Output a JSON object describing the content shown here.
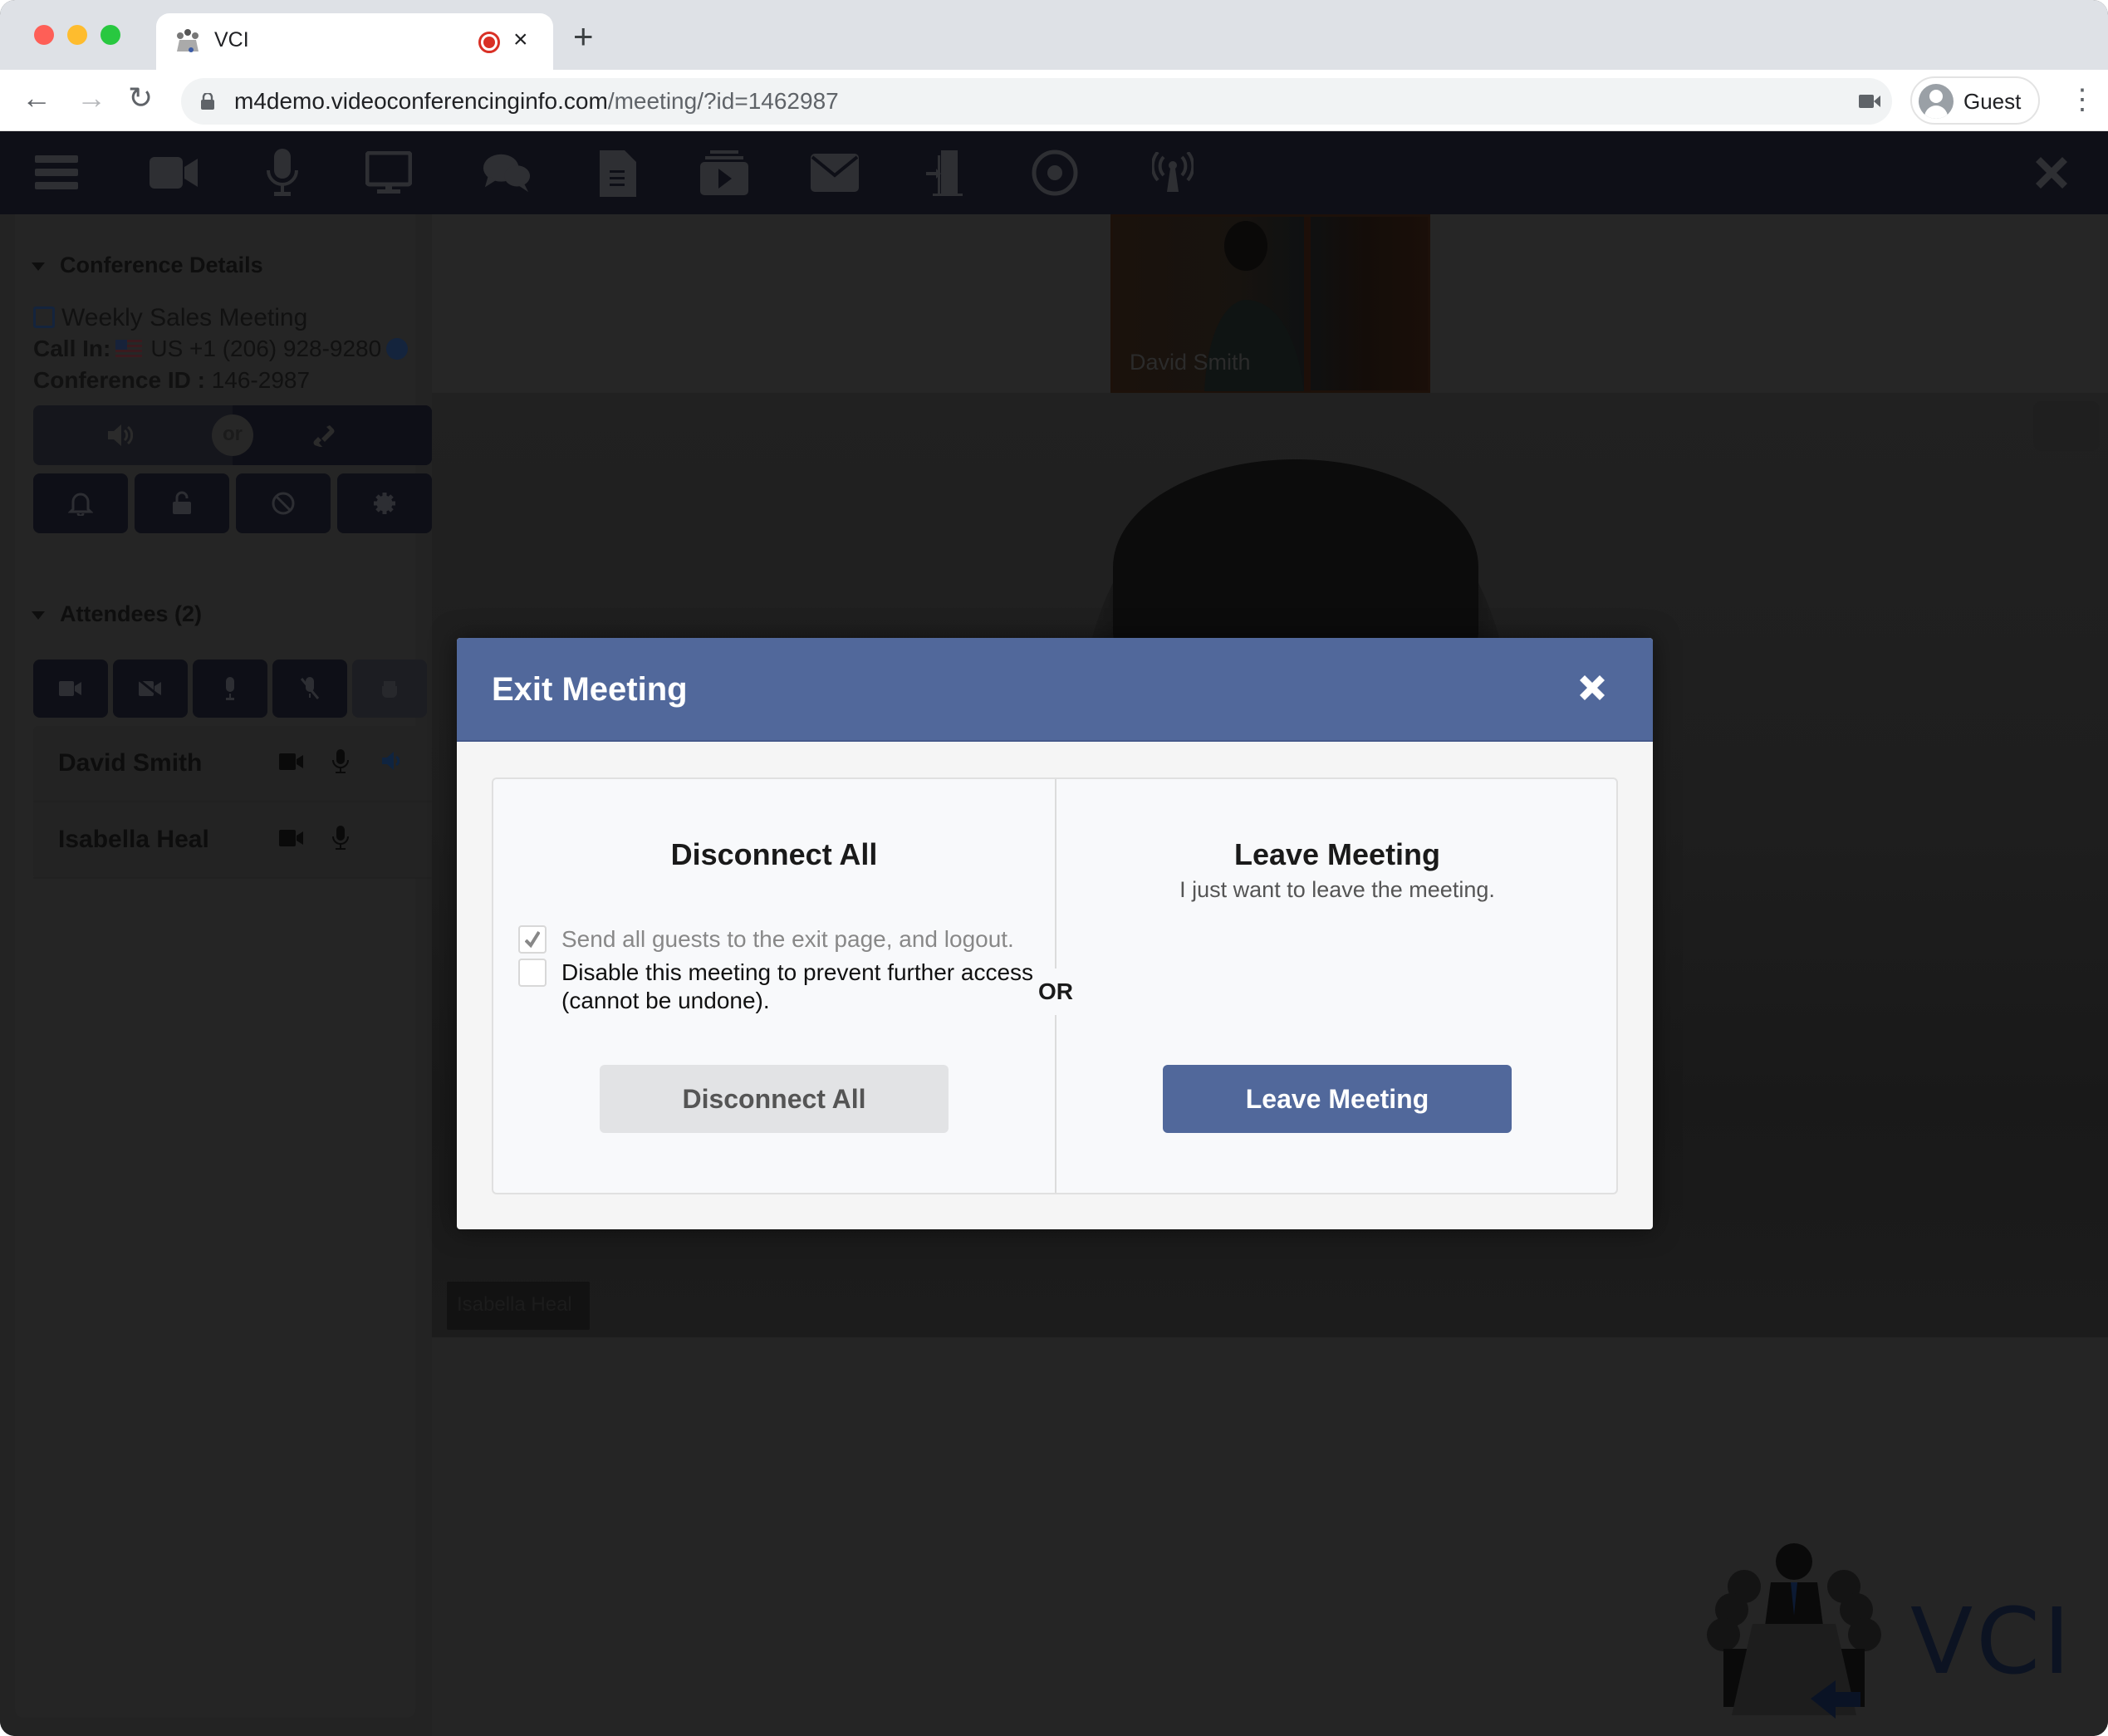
{
  "browser": {
    "tab_title": "VCI",
    "tab_close": "×",
    "new_tab": "+",
    "url_host": "m4demo.videoconferencinginfo.com",
    "url_path": "/meeting/?id=1462987",
    "profile_name": "Guest",
    "nav": {
      "back": "←",
      "forward": "→",
      "reload": "↻",
      "menu": "⋮"
    }
  },
  "toolbar": {
    "items": [
      {
        "name": "menu-icon"
      },
      {
        "name": "video-camera-icon"
      },
      {
        "name": "microphone-icon"
      },
      {
        "name": "screen-share-icon"
      },
      {
        "name": "chat-icon"
      },
      {
        "name": "document-icon"
      },
      {
        "name": "media-player-icon"
      },
      {
        "name": "email-icon"
      },
      {
        "name": "exit-door-icon"
      },
      {
        "name": "record-icon"
      },
      {
        "name": "broadcast-icon"
      }
    ],
    "close": "close-icon"
  },
  "sidebar": {
    "conference": {
      "heading": "Conference Details",
      "meeting_name": "Weekly Sales Meeting",
      "call_in_label": "Call In:",
      "call_in_number": "US +1 (206) 928-9280",
      "conference_id_label": "Conference ID :",
      "conference_id": "146-2987",
      "audio_or": "or"
    },
    "attendees": {
      "heading": "Attendees (2)",
      "list": [
        {
          "name": "David Smith",
          "video": true,
          "mic": true,
          "speaking": true
        },
        {
          "name": "Isabella Heal",
          "video": true,
          "mic": true,
          "speaking": false
        }
      ]
    }
  },
  "video": {
    "thumbnail_label": "David Smith",
    "main_label": "Isabella Heal"
  },
  "logo": {
    "text": "VCI"
  },
  "modal": {
    "title": "Exit Meeting",
    "close": "✕",
    "or_label": "OR",
    "disconnect": {
      "title": "Disconnect All",
      "options": [
        {
          "label": "Send all guests to the exit page, and logout.",
          "checked": true
        },
        {
          "label": "Disable this meeting to prevent further access (cannot be undone).",
          "checked": false
        }
      ],
      "button": "Disconnect All"
    },
    "leave": {
      "title": "Leave Meeting",
      "subtitle": "I just want to leave the meeting.",
      "button": "Leave Meeting"
    }
  },
  "colors": {
    "modal_header": "#51689b",
    "leave_button": "#51689b",
    "toolbar_bg": "#0e0f17"
  }
}
